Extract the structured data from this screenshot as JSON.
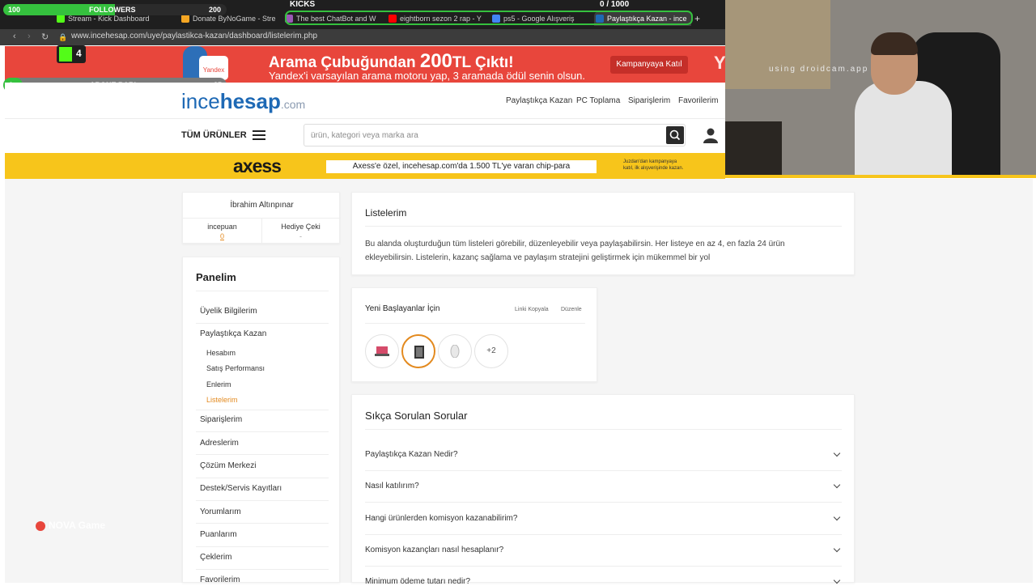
{
  "overlays": {
    "followers": {
      "label": "FOLLOWERS",
      "current": "100",
      "goal": "200",
      "progress": 0.5
    },
    "kicks": {
      "label": "KICKS",
      "value": "0  / 1000",
      "progress": 0.0
    },
    "kick_count": "4",
    "abone": {
      "label": "ABONE BARI",
      "current": "0",
      "goal": "25",
      "progress": 0.04
    },
    "webcam_text": "using droidcam.app",
    "watermark": "NOVA Game"
  },
  "browser": {
    "tabs": [
      {
        "label": "Stream - Kick Dashboard",
        "color": "#53fc18"
      },
      {
        "label": "Donate ByNoGame - Stre",
        "color": "#f5a623"
      },
      {
        "label": "The best ChatBot and W",
        "color": "#9b59b6"
      },
      {
        "label": "eightborn sezon 2 rap - Y",
        "color": "#ff0000"
      },
      {
        "label": "ps5 - Google Alışveriş",
        "color": "#4285f4"
      },
      {
        "label": "Paylaştıkça Kazan - ince",
        "color": "#1e69b5"
      }
    ],
    "new_tab": "+",
    "url": "www.incehesap.com/uye/paylastikca-kazan/dashboard/listelerim.php"
  },
  "banner": {
    "headline_pre": "Arama Çubuğundan ",
    "headline_amount": "200",
    "headline_post": "TL Çıktı!",
    "sub": "Yandex'i varsayılan arama motoru yap, 3 aramada ödül senin olsun.",
    "cta": "Kampanyaya Katıl",
    "chip": "Yandex",
    "logo_letter": "Y"
  },
  "header": {
    "logo_a": "ince",
    "logo_b": "hesap",
    "logo_c": ".com",
    "nav": [
      "Paylaştıkça Kazan",
      "PC Toplama",
      "Siparişlerim",
      "Favorilerim"
    ],
    "all_products": "TÜM ÜRÜNLER",
    "search_placeholder": "ürün, kategori veya marka ara"
  },
  "axess": {
    "brand": "axess",
    "message": "Axess'e özel, incehesap.com'da 1.500 TL'ye varan chip-para",
    "small": "Juzdan'dan kampanyaya katıl, ilk alışverişinde kazan."
  },
  "profile": {
    "name": "İbrahim Altınpınar",
    "incepuan_label": "incepuan",
    "incepuan_value": "0",
    "gift_label": "Hediye Çeki",
    "gift_value": "-"
  },
  "panel": {
    "title": "Panelim",
    "items": [
      "Üyelik Bilgilerim",
      "Paylaştıkça Kazan"
    ],
    "subitems": [
      "Hesabım",
      "Satış Performansı",
      "Enlerim",
      "Listelerim"
    ],
    "items2": [
      "Siparişlerim",
      "Adreslerim",
      "Çözüm Merkezi",
      "Destek/Servis Kayıtları",
      "Yorumlarım",
      "Puanlarım",
      "Çeklerim",
      "Favorilerim"
    ]
  },
  "intro": {
    "title": "Listelerim",
    "text": "Bu alanda oluşturduğun tüm listeleri görebilir, düzenleyebilir veya paylaşabilirsin. Her listeye en az 4, en fazla 24 ürün ekleyebilirsin. Listelerin, kazanç sağlama ve paylaşım stratejini geliştirmek için mükemmel bir yol"
  },
  "list": {
    "title": "Yeni Başlayanlar İçin",
    "copy_link": "Linki Kopyala",
    "edit": "Düzenle",
    "more": "+2"
  },
  "faq": {
    "title": "Sıkça Sorulan Sorular",
    "questions": [
      "Paylaştıkça Kazan Nedir?",
      "Nasıl katılırım?",
      "Hangi ürünlerden komisyon kazanabilirim?",
      "Komisyon kazançları nasıl hesaplanır?",
      "Minimum ödeme tutarı nedir?"
    ]
  },
  "colors": {
    "accent": "#e38a1f",
    "brand_blue": "#1e69b5",
    "banner_red": "#e8463c",
    "axess_yellow": "#f7c51b",
    "kick_green": "#53fc18"
  }
}
